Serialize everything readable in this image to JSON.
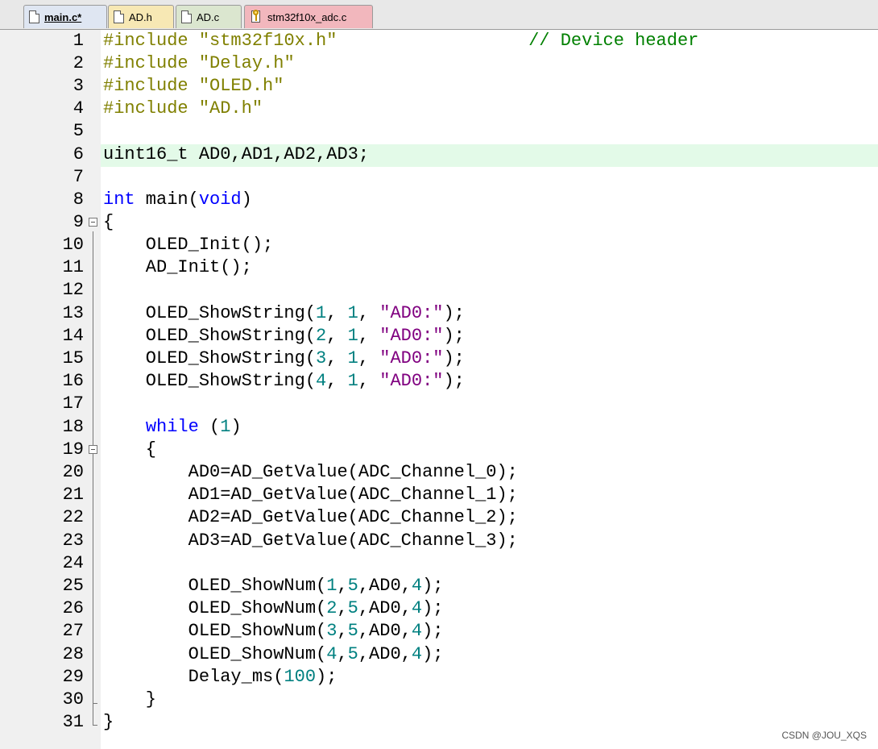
{
  "tabs": [
    {
      "label": "main.c*",
      "active": true
    },
    {
      "label": "AD.h",
      "active": false
    },
    {
      "label": "AD.c",
      "active": false
    },
    {
      "label": "stm32f10x_adc.c",
      "active": false
    }
  ],
  "lines": [
    {
      "n": "1"
    },
    {
      "n": "2"
    },
    {
      "n": "3"
    },
    {
      "n": "4"
    },
    {
      "n": "5"
    },
    {
      "n": "6"
    },
    {
      "n": "7"
    },
    {
      "n": "8"
    },
    {
      "n": "9"
    },
    {
      "n": "10"
    },
    {
      "n": "11"
    },
    {
      "n": "12"
    },
    {
      "n": "13"
    },
    {
      "n": "14"
    },
    {
      "n": "15"
    },
    {
      "n": "16"
    },
    {
      "n": "17"
    },
    {
      "n": "18"
    },
    {
      "n": "19"
    },
    {
      "n": "20"
    },
    {
      "n": "21"
    },
    {
      "n": "22"
    },
    {
      "n": "23"
    },
    {
      "n": "24"
    },
    {
      "n": "25"
    },
    {
      "n": "26"
    },
    {
      "n": "27"
    },
    {
      "n": "28"
    },
    {
      "n": "29"
    },
    {
      "n": "30"
    },
    {
      "n": "31"
    }
  ],
  "code": {
    "l1a": "#include ",
    "l1b": "\"stm32f10x.h\"",
    "l1c": "                  ",
    "l1d": "// Device header",
    "l2a": "#include ",
    "l2b": "\"Delay.h\"",
    "l3a": "#include ",
    "l3b": "\"OLED.h\"",
    "l4a": "#include ",
    "l4b": "\"AD.h\"",
    "l6": "uint16_t AD0,AD1,AD2,AD3;",
    "l8a": "int",
    "l8b": " main(",
    "l8c": "void",
    "l8d": ")",
    "l9": "{",
    "l10": "    OLED_Init();",
    "l11": "    AD_Init();",
    "s13a": "    OLED_ShowString(",
    "s13b": "1",
    "s13c": ", ",
    "s13d": "1",
    "s13e": ", ",
    "s13f": "\"AD0:\"",
    "s13g": ");",
    "s14a": "    OLED_ShowString(",
    "s14b": "2",
    "s14c": ", ",
    "s14d": "1",
    "s14e": ", ",
    "s14f": "\"AD0:\"",
    "s14g": ");",
    "s15a": "    OLED_ShowString(",
    "s15b": "3",
    "s15c": ", ",
    "s15d": "1",
    "s15e": ", ",
    "s15f": "\"AD0:\"",
    "s15g": ");",
    "s16a": "    OLED_ShowString(",
    "s16b": "4",
    "s16c": ", ",
    "s16d": "1",
    "s16e": ", ",
    "s16f": "\"AD0:\"",
    "s16g": ");",
    "l18a": "    ",
    "l18b": "while",
    "l18c": " (",
    "l18d": "1",
    "l18e": ")",
    "l19": "    {",
    "l20": "        AD0=AD_GetValue(ADC_Channel_0);",
    "l21": "        AD1=AD_GetValue(ADC_Channel_1);",
    "l22": "        AD2=AD_GetValue(ADC_Channel_2);",
    "l23": "        AD3=AD_GetValue(ADC_Channel_3);",
    "n25a": "        OLED_ShowNum(",
    "n25b": "1",
    "n25c": ",",
    "n25d": "5",
    "n25e": ",AD0,",
    "n25f": "4",
    "n25g": ");",
    "n26a": "        OLED_ShowNum(",
    "n26b": "2",
    "n26c": ",",
    "n26d": "5",
    "n26e": ",AD0,",
    "n26f": "4",
    "n26g": ");",
    "n27a": "        OLED_ShowNum(",
    "n27b": "3",
    "n27c": ",",
    "n27d": "5",
    "n27e": ",AD0,",
    "n27f": "4",
    "n27g": ");",
    "n28a": "        OLED_ShowNum(",
    "n28b": "4",
    "n28c": ",",
    "n28d": "5",
    "n28e": ",AD0,",
    "n28f": "4",
    "n28g": ");",
    "l29a": "        Delay_ms(",
    "l29b": "100",
    "l29c": ");",
    "l30": "    }",
    "l31": "}"
  },
  "watermark": "CSDN @JOU_XQS",
  "colors": {
    "keyword": "#0000ff",
    "preprocessor": "#808000",
    "comment": "#008000",
    "number": "#008080",
    "string": "#800080",
    "current_line": "#e3fae8"
  }
}
